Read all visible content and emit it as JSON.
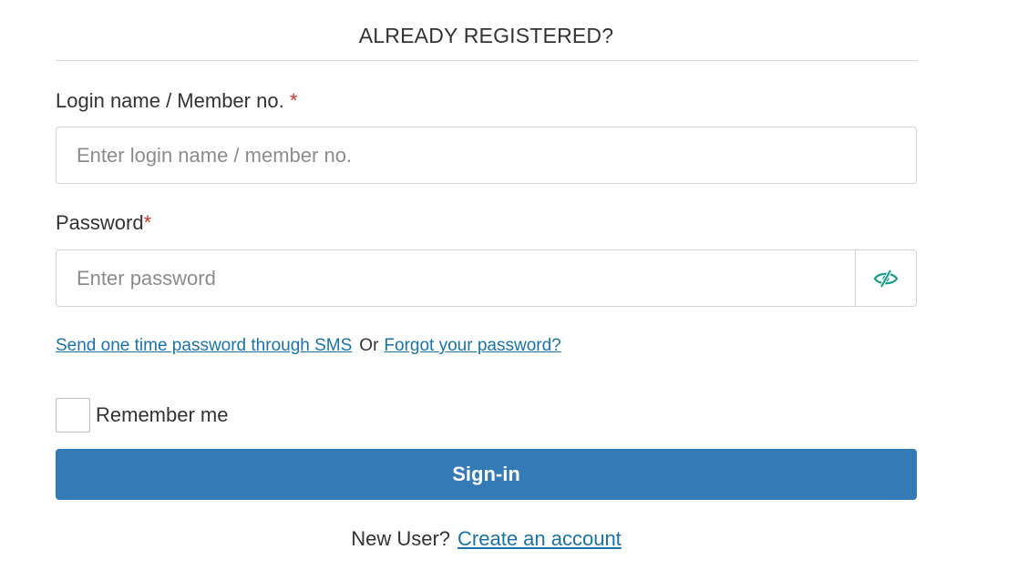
{
  "section": {
    "heading": "ALREADY REGISTERED?"
  },
  "login_field": {
    "label": "Login name / Member no.",
    "required_mark": "*",
    "placeholder": "Enter login name / member no.",
    "value": ""
  },
  "password_field": {
    "label": "Password",
    "required_mark": "*",
    "placeholder": "Enter password",
    "value": "",
    "toggle_icon": "eye-slash-icon"
  },
  "links": {
    "sms_otp": "Send one time password through SMS",
    "separator": "Or",
    "forgot_password": "Forgot your password?"
  },
  "remember": {
    "label": "Remember me",
    "checked": false
  },
  "actions": {
    "signin_label": "Sign-in"
  },
  "footer": {
    "new_user_text": "New User?",
    "create_account_label": "Create an account"
  },
  "colors": {
    "primary": "#337ab7",
    "link": "#1a73a8",
    "required": "#c0392b",
    "icon_accent": "#1a9e8a"
  }
}
